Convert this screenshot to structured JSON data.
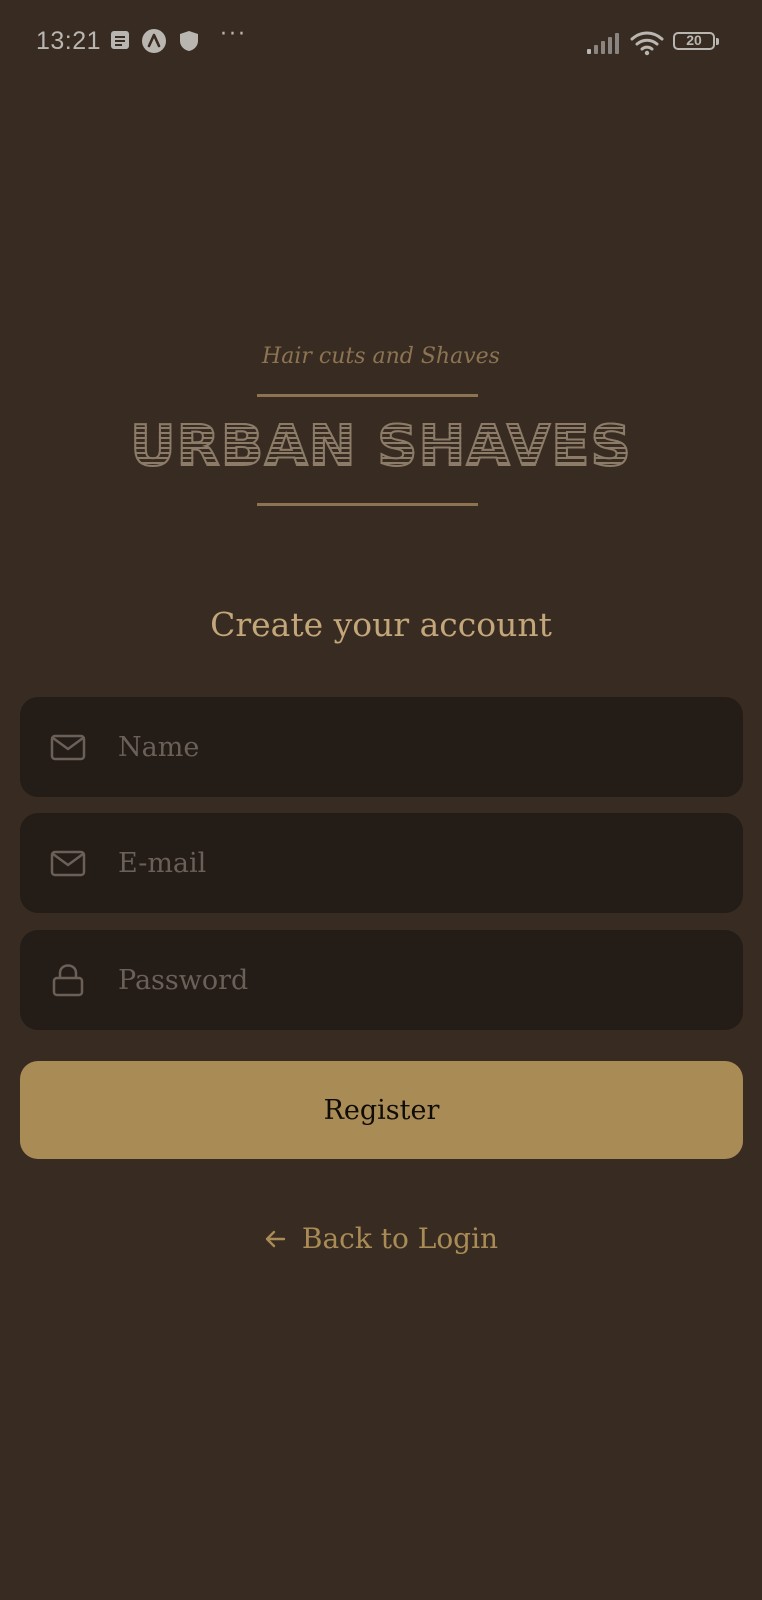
{
  "status_bar": {
    "time": "13:21",
    "battery_level": "20",
    "icons": [
      "notes-icon",
      "navigation-icon",
      "shield-icon",
      "more-dots-icon",
      "signal-icon",
      "wifi-icon",
      "battery-icon"
    ]
  },
  "logo": {
    "tagline": "Hair cuts and Shaves",
    "title": "URBAN SHAVES"
  },
  "form": {
    "heading": "Create your account",
    "name_placeholder": "Name",
    "name_icon": "mail-icon",
    "email_placeholder": "E-mail",
    "email_icon": "mail-icon",
    "password_placeholder": "Password",
    "password_icon": "lock-icon",
    "register_label": "Register"
  },
  "back": {
    "label": "Back to Login",
    "icon": "arrow-left-icon"
  },
  "colors": {
    "background": "#382c22",
    "field_background": "#241c17",
    "accent": "#a98b56",
    "heading": "#c3a77a",
    "placeholder": "#6b6058",
    "button_text": "#100c08"
  }
}
